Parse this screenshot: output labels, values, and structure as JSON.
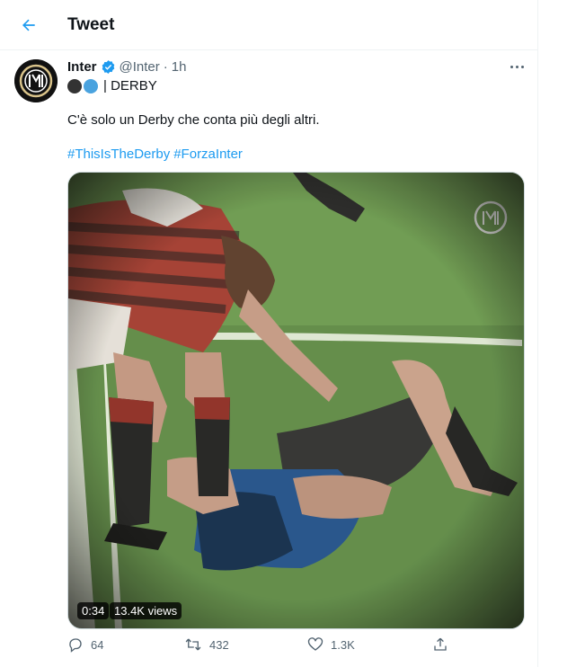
{
  "header": {
    "title": "Tweet",
    "back_icon": "arrow-left-icon"
  },
  "tweet": {
    "author": {
      "display_name": "Inter",
      "handle": "@Inter",
      "verified_icon": "verified-badge-icon",
      "avatar_icon": "inter-crest-icon"
    },
    "separator": "·",
    "time": "1h",
    "bio": {
      "circle_colors": [
        "#333333",
        "#4aa3df"
      ],
      "text": "| DERBY"
    },
    "text": "C'è solo un Derby che conta più degli altri.",
    "hashtags": [
      "#ThisIsTheDerby",
      "#ForzaInter"
    ],
    "video": {
      "duration": "0:34",
      "views": "13.4K views"
    },
    "actions": {
      "replies": "64",
      "retweets": "432",
      "likes": "1.3K"
    }
  },
  "colors": {
    "accent": "#1d9bf0",
    "secondary_text": "#536471"
  }
}
